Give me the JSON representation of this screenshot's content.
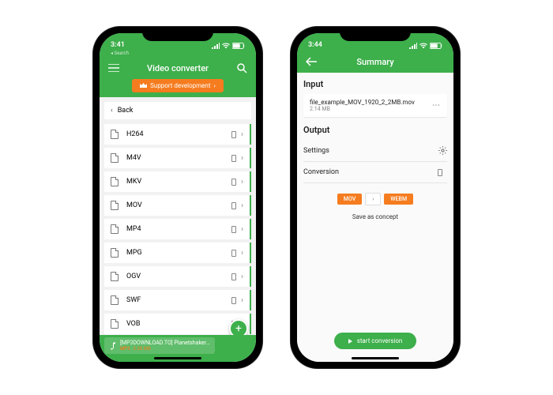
{
  "colors": {
    "accent": "#3DAF4B",
    "orange": "#F57C1F"
  },
  "phone1": {
    "status_time": "3:41",
    "status_search": "◂ Search",
    "header_title": "Video converter",
    "banner_label": "Support development",
    "back_label": "Back",
    "formats": [
      "H264",
      "M4V",
      "MKV",
      "MOV",
      "MP4",
      "MPG",
      "OGV",
      "SWF",
      "VOB"
    ],
    "bottom": {
      "filename": "[MP3DOWNLOAD.TO] Planetshakers…",
      "tag": "MP3",
      "size": "3.28 MB"
    }
  },
  "phone2": {
    "status_time": "3:44",
    "header_title": "Summary",
    "input_title": "Input",
    "input_file": "file_example_MOV_1920_2_2MB.mov",
    "input_size": "2.14 MB",
    "output_title": "Output",
    "settings_label": "Settings",
    "conversion_label": "Conversion",
    "format_from": "MOV",
    "format_to": "WEBM",
    "save_concept": "Save as concept",
    "start_label": "start conversion"
  }
}
